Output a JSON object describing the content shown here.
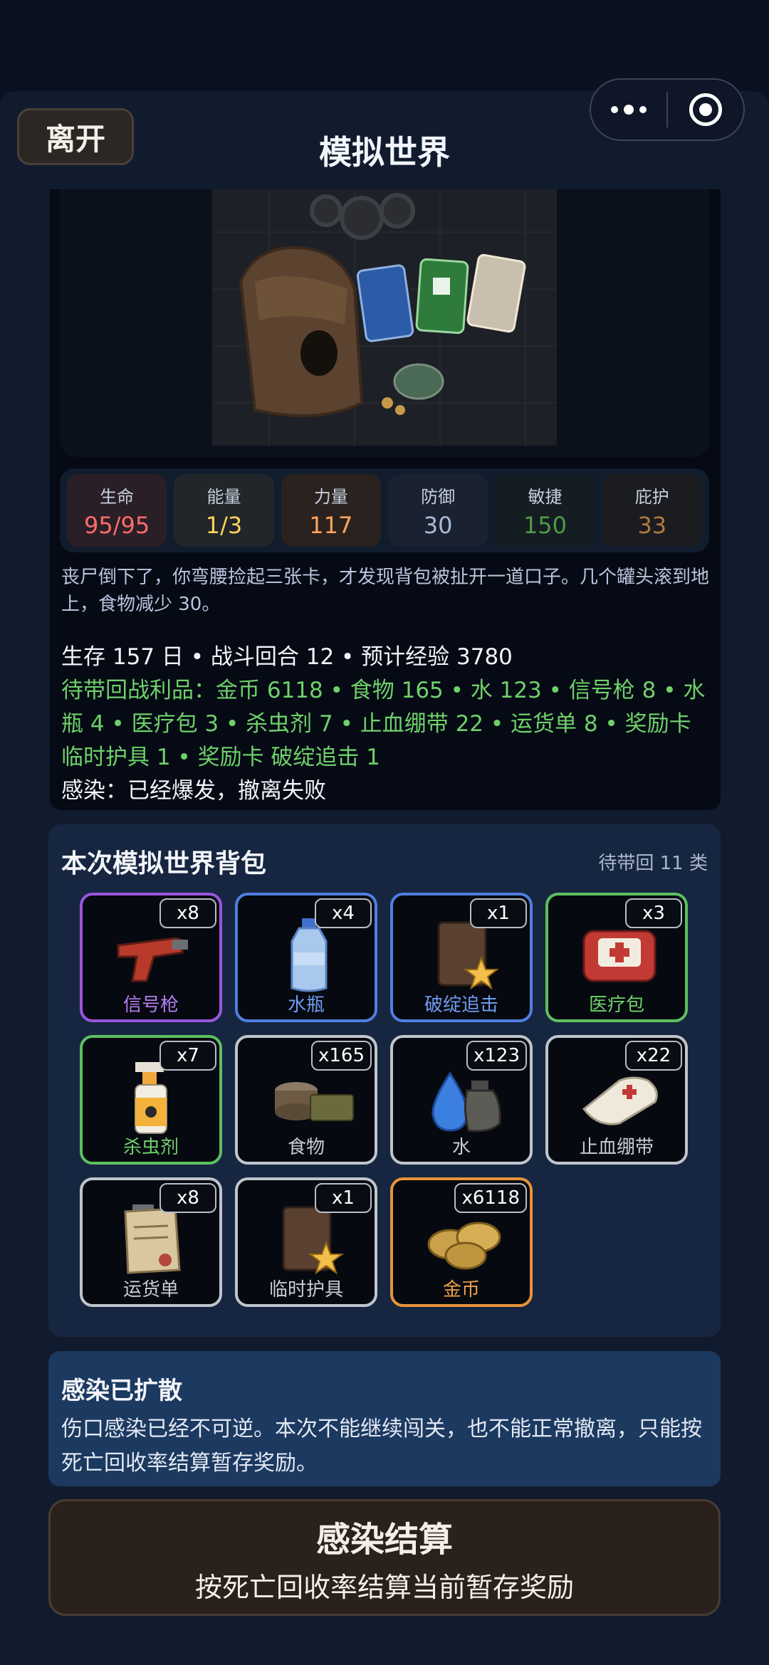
{
  "header": {
    "leave_label": "离开",
    "title": "模拟世界"
  },
  "stats": [
    {
      "label": "生命",
      "value": "95/95",
      "color": "#ff6b6b"
    },
    {
      "label": "能量",
      "value": "1/3",
      "color": "#ffd35c"
    },
    {
      "label": "力量",
      "value": "117",
      "color": "#ffa35c"
    },
    {
      "label": "防御",
      "value": "30",
      "color": "#aabbd6"
    },
    {
      "label": "敏捷",
      "value": "150",
      "color": "#4f9a48"
    },
    {
      "label": "庇护",
      "value": "33",
      "color": "#b07a3e"
    }
  ],
  "narration": "丧尸倒下了，你弯腰捡起三张卡，才发现背包被扯开一道口子。几个罐头滚到地上，食物减少 30。",
  "summary": {
    "survival": "生存 157 日 • 战斗回合 12 • 预计经验 3780",
    "loot": "待带回战利品：金币 6118 • 食物 165 • 水 123 • 信号枪 8 • 水瓶 4 • 医疗包 3 • 杀虫剂 7 • 止血绷带 22 • 运货单 8 • 奖励卡 临时护具 1 • 奖励卡 破绽追击 1",
    "infection": "感染：已经爆发，撤离失败"
  },
  "bag": {
    "title": "本次模拟世界背包",
    "count": "待带回 11 类",
    "items": [
      {
        "name": "信号枪",
        "qty": "x8",
        "icon": "flare-gun-icon",
        "border": "#9a55e0",
        "name_color": "#b57cf0"
      },
      {
        "name": "水瓶",
        "qty": "x4",
        "icon": "water-bottle-icon",
        "border": "#4f7fe0",
        "name_color": "#6f9cf0"
      },
      {
        "name": "破绽追击",
        "qty": "x1",
        "icon": "star-book-icon",
        "border": "#4f7fe0",
        "name_color": "#6f9cf0"
      },
      {
        "name": "医疗包",
        "qty": "x3",
        "icon": "medkit-icon",
        "border": "#5cc060",
        "name_color": "#6fd06a"
      },
      {
        "name": "杀虫剂",
        "qty": "x7",
        "icon": "spray-bottle-icon",
        "border": "#5cc060",
        "name_color": "#6fd06a"
      },
      {
        "name": "食物",
        "qty": "x165",
        "icon": "food-can-icon",
        "border": "#c0c4cc",
        "name_color": "#c8ccd4"
      },
      {
        "name": "水",
        "qty": "x123",
        "icon": "water-drop-icon",
        "border": "#c0c4cc",
        "name_color": "#c8ccd4"
      },
      {
        "name": "止血绷带",
        "qty": "x22",
        "icon": "bandage-icon",
        "border": "#c0c4cc",
        "name_color": "#c8ccd4"
      },
      {
        "name": "运货单",
        "qty": "x8",
        "icon": "clipboard-icon",
        "border": "#c0c4cc",
        "name_color": "#c8ccd4"
      },
      {
        "name": "临时护具",
        "qty": "x1",
        "icon": "star-book-icon",
        "border": "#c0c4cc",
        "name_color": "#c8ccd4"
      },
      {
        "name": "金币",
        "qty": "x6118",
        "icon": "gold-coins-icon",
        "border": "#e8933a",
        "name_color": "#f0a04a"
      }
    ]
  },
  "infection_notice": {
    "title": "感染已扩散",
    "text": "伤口感染已经不可逆。本次不能继续闯关，也不能正常撤离，只能按死亡回收率结算暂存奖励。"
  },
  "settle_button": {
    "title": "感染结算",
    "subtitle": "按死亡回收率结算当前暂存奖励"
  }
}
